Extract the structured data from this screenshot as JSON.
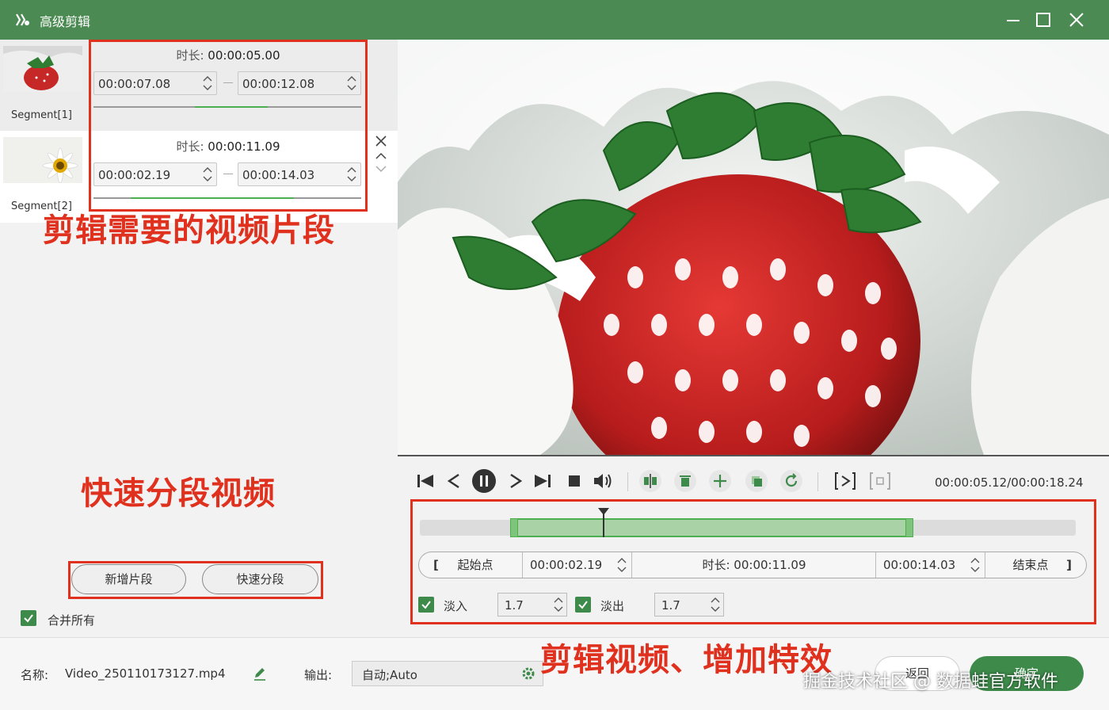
{
  "window": {
    "title": "高级剪辑"
  },
  "segments": [
    {
      "name": "Segment[1]",
      "duration_label": "时长:",
      "duration": "00:00:05.00",
      "start": "00:00:07.08",
      "end": "00:00:12.08",
      "track_fill": [
        0.38,
        0.65
      ]
    },
    {
      "name": "Segment[2]",
      "duration_label": "时长:",
      "duration": "00:00:11.09",
      "start": "00:00:02.19",
      "end": "00:00:14.03",
      "track_fill": [
        0.14,
        0.75
      ]
    }
  ],
  "annotations": {
    "segments_note": "剪辑需要的视频片段",
    "split_note": "快速分段视频",
    "edit_note": "剪辑视频、增加特效"
  },
  "left_actions": {
    "add_segment": "新增片段",
    "quick_split": "快速分段",
    "merge_all_label": "合并所有",
    "merge_all_checked": true
  },
  "player": {
    "time_readout": "00:00:05.12/00:00:18.24",
    "icons": [
      "skip-start-icon",
      "step-back-icon",
      "pause-icon",
      "step-forward-icon",
      "skip-end-icon",
      "stop-icon",
      "volume-icon",
      "split-icon",
      "delete-icon",
      "add-icon",
      "copy-icon",
      "reset-icon",
      "preview-segment-icon",
      "fullscreen-icon"
    ]
  },
  "timeline": {
    "selection_start_fraction": 0.14,
    "selection_end_fraction": 0.75,
    "playhead_fraction": 0.28
  },
  "range": {
    "start_button": "起始点",
    "start_value": "00:00:02.19",
    "duration_label": "时长:",
    "duration_value": "00:00:11.09",
    "end_value": "00:00:14.03",
    "end_button": "结束点"
  },
  "effects": {
    "fade_in_label": "淡入",
    "fade_in_value": "1.7",
    "fade_in_checked": true,
    "fade_out_label": "淡出",
    "fade_out_value": "1.7",
    "fade_out_checked": true
  },
  "bottom": {
    "name_label": "名称:",
    "filename": "Video_250110173127.mp4",
    "output_label": "输出:",
    "output_value": "自动;Auto",
    "back_button": "返回",
    "confirm_button": "确定",
    "watermark": "掘金技术社区 @ 数据蛙官方软件"
  },
  "colors": {
    "titlebar": "#4b8a52",
    "accent_green": "#3d8a4a",
    "annotation_red": "#e0301e"
  }
}
